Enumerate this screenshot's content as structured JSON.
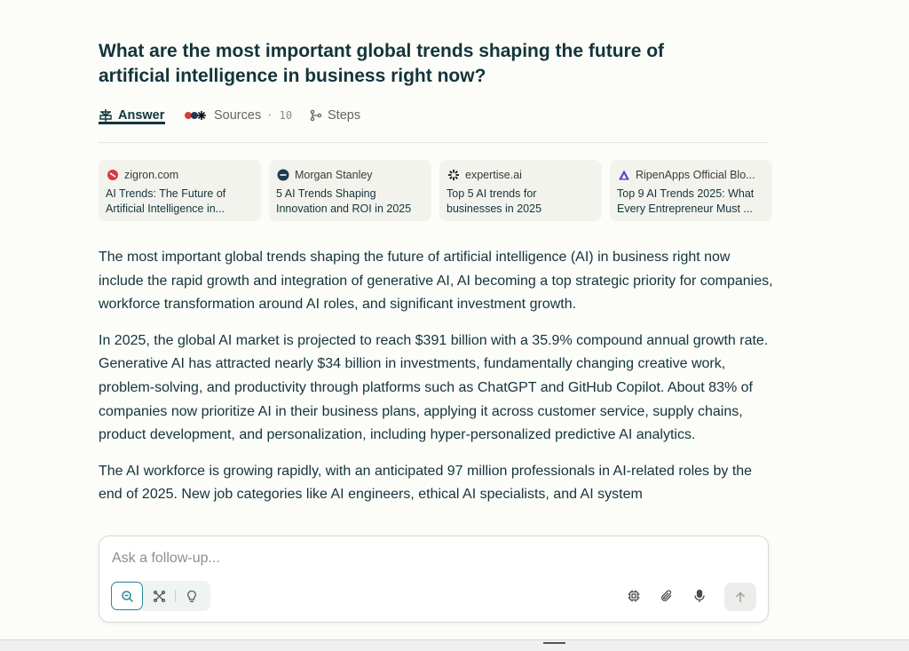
{
  "thread": {
    "question": "What are the most important global trends shaping the future of artificial intelligence in business right now?"
  },
  "tabs": [
    {
      "label": "Answer",
      "icon": "perplexity-icon"
    },
    {
      "label": "Sources",
      "count": "10",
      "icon": "source-favicons-icon"
    },
    {
      "label": "Steps",
      "icon": "steps-icon"
    }
  ],
  "sources": [
    {
      "domain": "zigron.com",
      "title": "AI Trends: The Future of Artificial Intelligence in...",
      "icon": "zigron-favicon",
      "color": "#d93a3a"
    },
    {
      "domain": "Morgan Stanley",
      "title": "5 AI Trends Shaping Innovation and ROI in 2025",
      "icon": "morgan-stanley-favicon",
      "color": "#1f3b57"
    },
    {
      "domain": "expertise.ai",
      "title": "Top 5 AI trends for businesses in 2025",
      "icon": "expertise-favicon",
      "color": "#111111"
    },
    {
      "domain": "RipenApps Official Blo...",
      "title": "Top 9 AI Trends 2025: What Every Entrepreneur Must ...",
      "icon": "ripenapps-favicon",
      "color": "#6a3cc9"
    }
  ],
  "answer": {
    "paragraphs": [
      "The most important global trends shaping the future of artificial intelligence (AI) in business right now include the rapid growth and integration of generative AI, AI becoming a top strategic priority for companies, workforce transformation around AI roles, and significant investment growth.",
      "In 2025, the global AI market is projected to reach $391 billion with a 35.9% compound annual growth rate. Generative AI has attracted nearly $34 billion in investments, fundamentally changing creative work, problem-solving, and productivity through platforms such as ChatGPT and GitHub Copilot. About 83% of companies now prioritize AI in their business plans, applying it across customer service, supply chains, product development, and personalization, including hyper-personalized predictive AI analytics.",
      "The AI workforce is growing rapidly, with an anticipated 97 million professionals in AI-related roles by the end of 2025. New job categories like AI engineers, ethical AI specialists, and AI system"
    ]
  },
  "composer": {
    "placeholder": "Ask a follow-up...",
    "modes": [
      "search-icon",
      "research-icon",
      "labs-icon"
    ],
    "tools": [
      "model-chip-icon",
      "attach-icon",
      "microphone-icon"
    ],
    "send_icon": "arrow-up-icon"
  },
  "colors": {
    "accent": "#2a8a95",
    "text": "#13343b",
    "background": "#fcfcf9"
  }
}
